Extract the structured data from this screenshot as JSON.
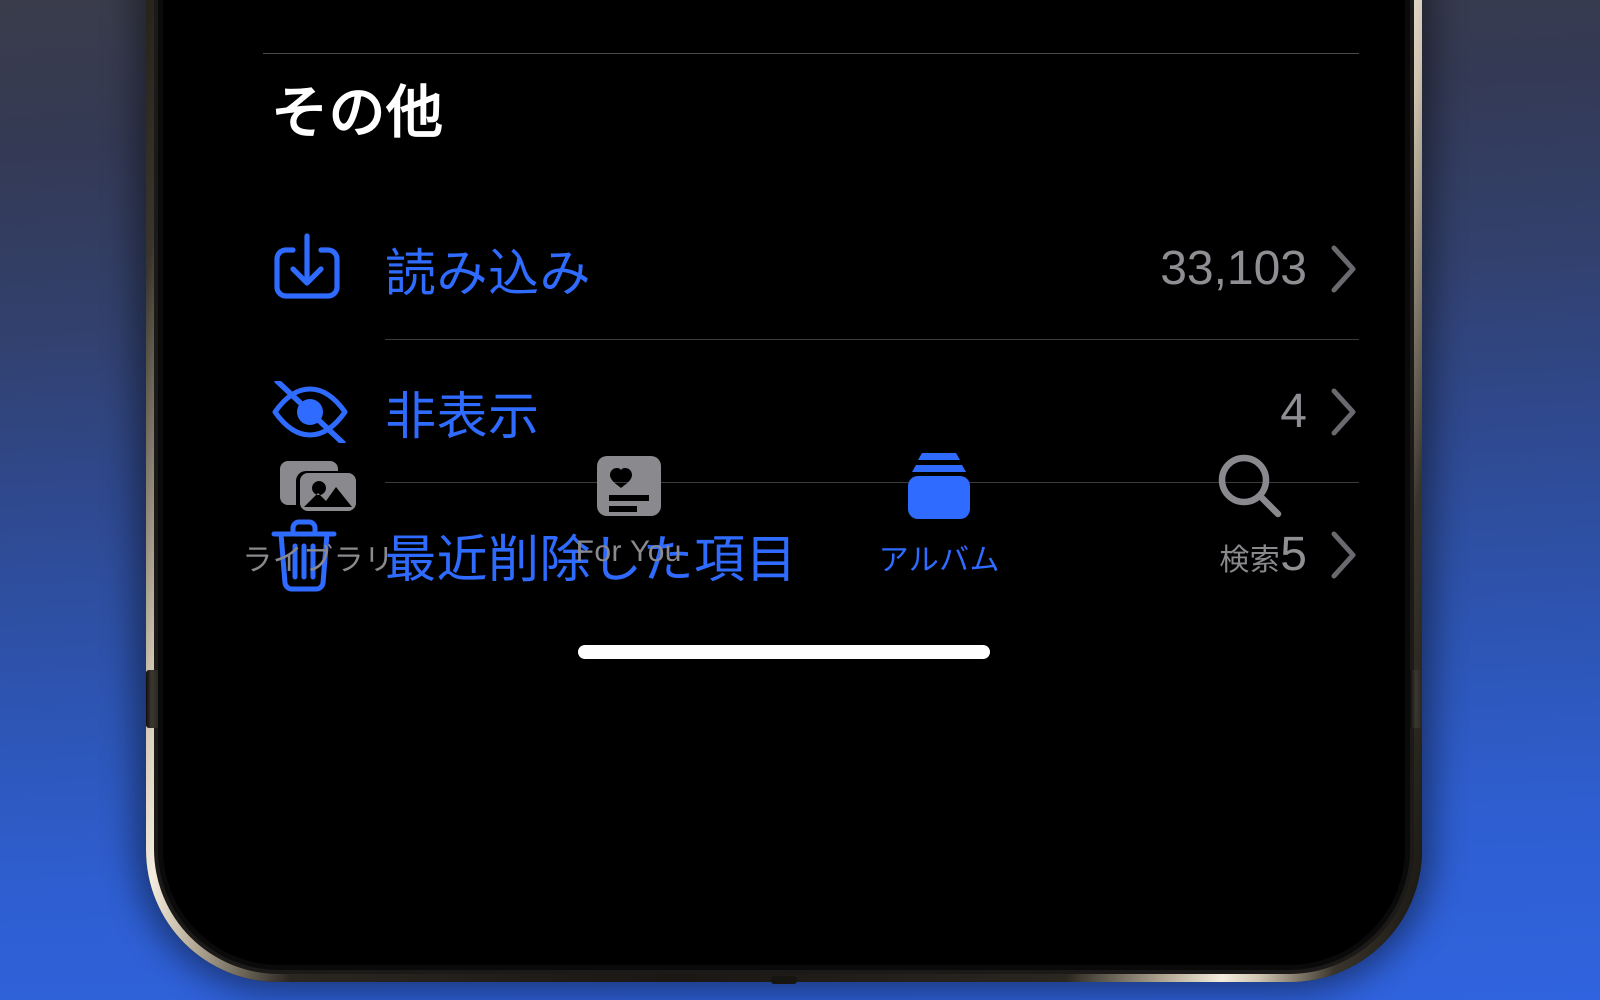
{
  "device": {
    "name": "iphone-frame",
    "rim_color": "#f4ecdd",
    "body_color": "#0b0b0c"
  },
  "wallpaper": {
    "gradient_top": "#3a3c4b",
    "gradient_bottom": "#3063df"
  },
  "app": {
    "name": "Photos",
    "accent_color": "#2f6bff",
    "secondary_text_color": "#8e8e93",
    "background_color": "#000000"
  },
  "section": {
    "title": "その他",
    "rows": [
      {
        "icon": "import-icon",
        "label": "読み込み",
        "count": "33,103",
        "chevron": "chevron-right-icon"
      },
      {
        "icon": "eye-slash-icon",
        "label": "非表示",
        "count": "4",
        "chevron": "chevron-right-icon"
      },
      {
        "icon": "trash-icon",
        "label": "最近削除した項目",
        "count": "5",
        "chevron": "chevron-right-icon"
      }
    ]
  },
  "tabbar": {
    "active_index": 2,
    "tabs": [
      {
        "label": "ライブラリ",
        "icon": "photo-stack-icon",
        "active": false
      },
      {
        "label": "For You",
        "icon": "heart-card-icon",
        "active": false
      },
      {
        "label": "アルバム",
        "icon": "albums-icon",
        "active": true
      },
      {
        "label": "検索",
        "icon": "search-icon",
        "active": false
      }
    ]
  },
  "home_indicator": {
    "color": "#ffffff"
  }
}
